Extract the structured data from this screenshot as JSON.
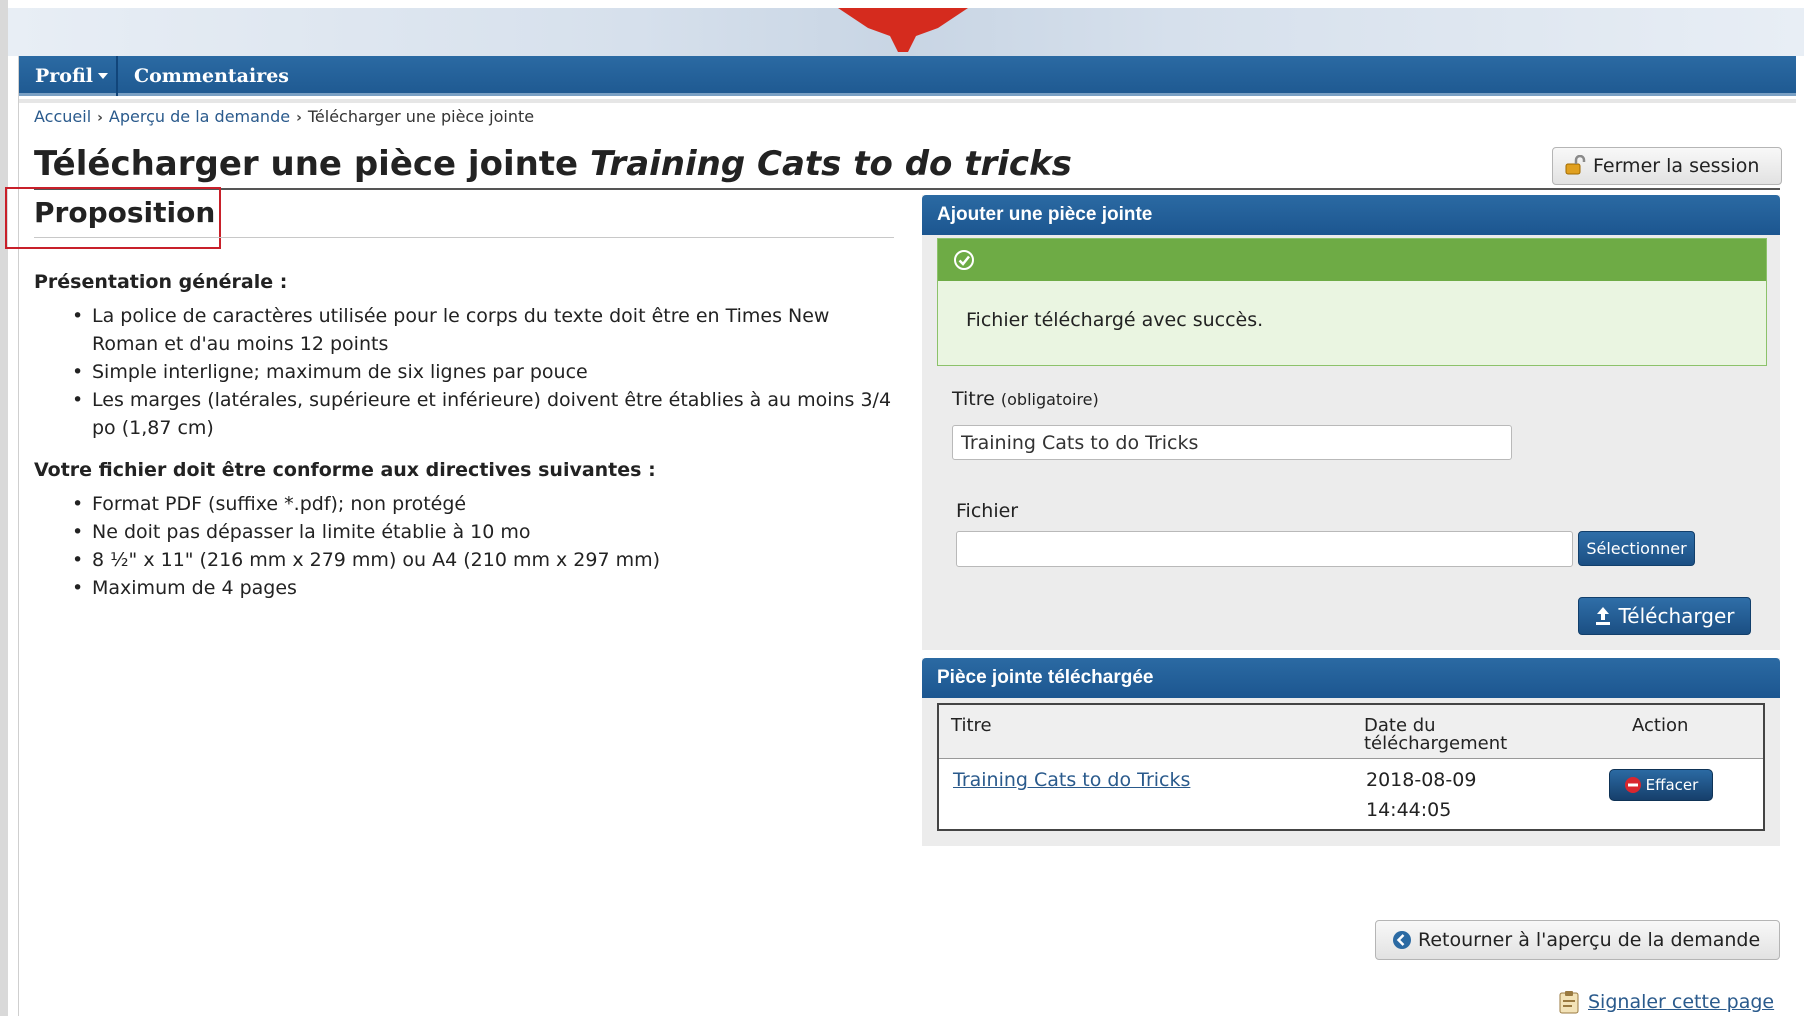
{
  "nav": {
    "profile": "Profil",
    "comments": "Commentaires"
  },
  "breadcrumb": {
    "home": "Accueil",
    "overview": "Aperçu de la demande",
    "current": "Télécharger une pièce jointe"
  },
  "header": {
    "title_prefix": "Télécharger une pièce jointe",
    "title_italic": "Training Cats to do tricks",
    "logout_label": "Fermer la session"
  },
  "left": {
    "section_title": "Proposition",
    "general_heading": "Présentation générale :",
    "general_items": [
      "La police de caractères utilisée pour le corps du texte doit être en Times New Roman et d'au moins 12 points",
      "Simple interligne; maximum de six lignes par pouce",
      "Les marges (latérales, supérieure et inférieure) doivent être établies à au moins 3/4 po (1,87 cm)"
    ],
    "file_heading": "Votre fichier doit être conforme aux directives suivantes :",
    "file_items": [
      "Format PDF (suffixe *.pdf); non protégé",
      "Ne doit pas dépasser la limite établie à 10 mo",
      "8 ½\" x 11\" (216 mm x 279 mm) ou A4 (210 mm x 297 mm)",
      "Maximum de 4 pages"
    ]
  },
  "add_panel": {
    "heading": "Ajouter une pièce jointe",
    "success_message": "Fichier téléchargé avec succès.",
    "title_label": "Titre",
    "title_required": "(obligatoire)",
    "title_value": "Training Cats to do Tricks",
    "file_label": "Fichier",
    "file_value": "",
    "select_button": "Sélectionner",
    "upload_button": "Télécharger"
  },
  "uploaded_panel": {
    "heading": "Pièce jointe téléchargée",
    "columns": {
      "title": "Titre",
      "date_line1": "Date du",
      "date_line2": "téléchargement",
      "action": "Action"
    },
    "rows": [
      {
        "title": "Training Cats to do Tricks",
        "date": "2018-08-09",
        "time": "14:44:05",
        "action": "Effacer"
      }
    ]
  },
  "footer": {
    "return_button": "Retourner à l'aperçu de la demande",
    "report_link": "Signaler cette page"
  },
  "colors": {
    "nav_blue": "#1f5a92",
    "success_green": "#6eab45",
    "highlight_red": "#c8202a",
    "link_blue": "#2a5a8c"
  }
}
